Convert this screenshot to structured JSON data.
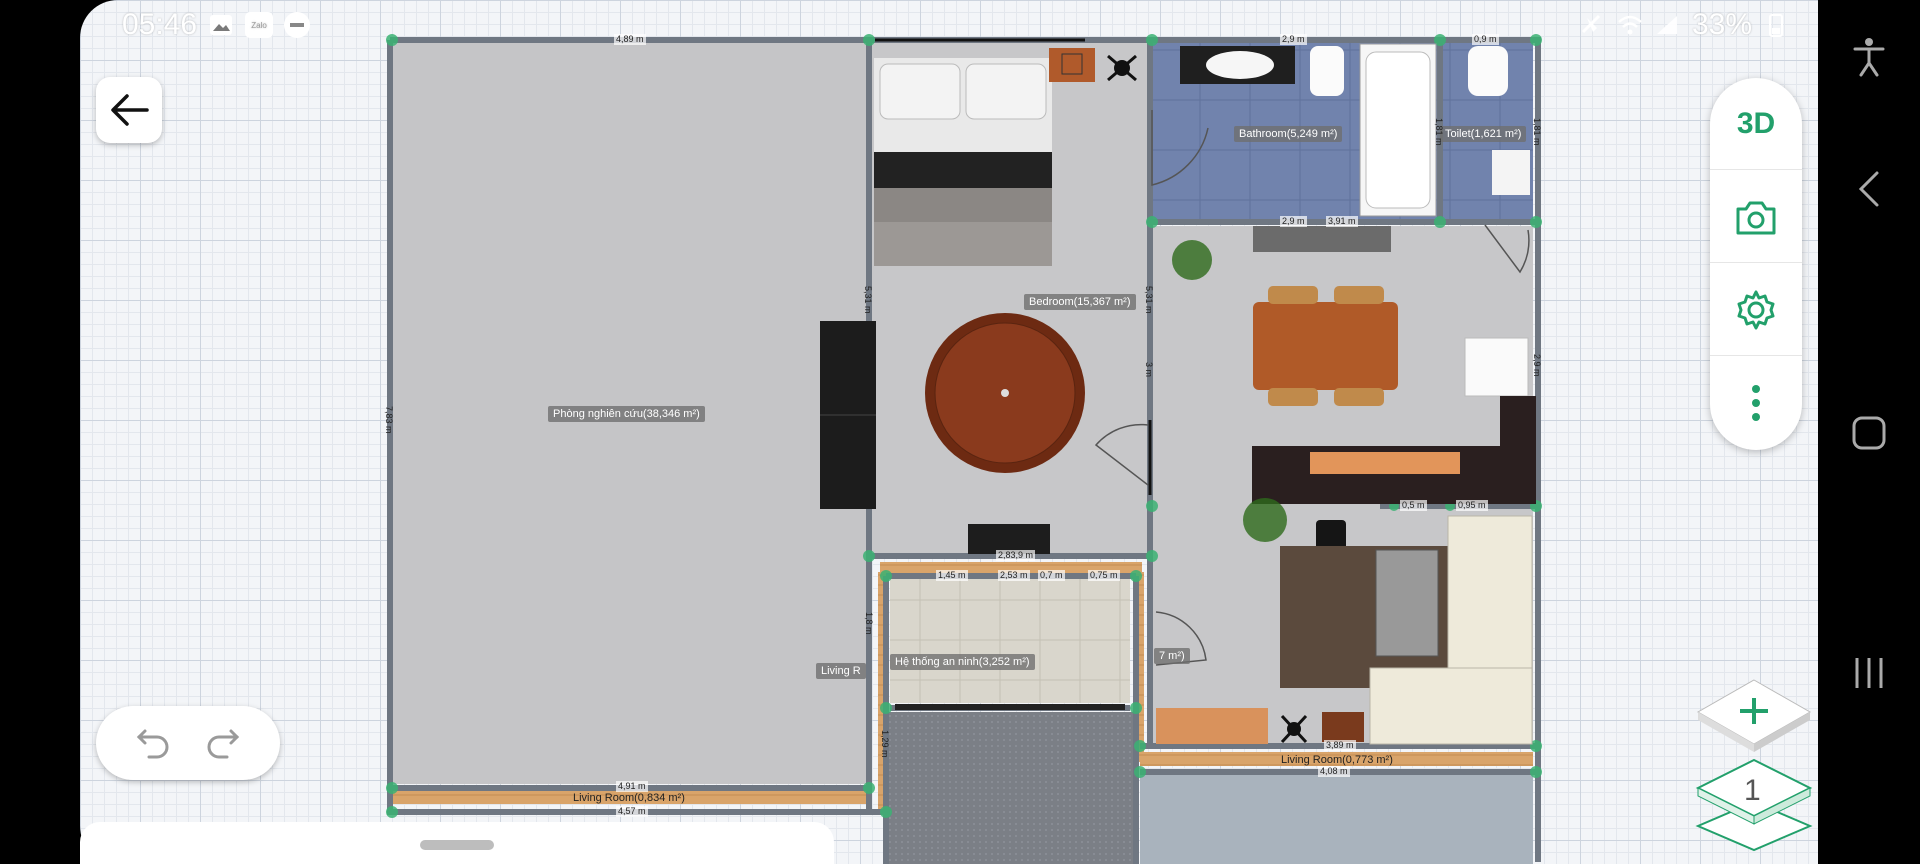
{
  "status_bar": {
    "time": "05:46",
    "notif_badge": "Zalo",
    "battery": "33%"
  },
  "rooms": {
    "study": "Phòng nghiên cứu(38,346 m²)",
    "bedroom": "Bedroom(15,367 m²)",
    "bathroom": "Bathroom(5,249 m²)",
    "toilet": "Toilet(1,621 m²)",
    "security": "Hệ thống an ninh(3,252 m²)",
    "living_small_left": "Living R",
    "living_partial": "7 m²)",
    "living_a": "Living Room(0,834 m²)",
    "living_b": "Living Room(0,773 m²)"
  },
  "dimensions": {
    "top_study": "4,89 m",
    "top_bath": "2,9 m",
    "top_toilet": "0,9 m",
    "bath_bottom_a": "2,9 m",
    "bath_bottom_b": "3,91 m",
    "bath_side": "1,81 m",
    "toilet_side": "1,81 m",
    "bedroom_left": "5,31 m",
    "bedroom_right": "5,31 m",
    "kitchen_side": "3 m",
    "kitchen_right": "2,9 m",
    "study_left": "7,83 m",
    "corr_a": "0,5 m",
    "corr_b": "0,95 m",
    "sec_top_a": "2,83,9 m",
    "sec_top_b": "1,45 m",
    "sec_top_c": "2,53 m",
    "sec_top_d": "0,7 m",
    "sec_top_e": "0,75 m",
    "sec_left": "1,8 m",
    "sec_left2": "1,29 m",
    "study_bottom": "4,91 m",
    "study_bottom2": "4,57 m",
    "living_bottom": "3,89 m",
    "living_bottom2": "4,08 m"
  },
  "controls": {
    "btn_3d": "3D",
    "floor_number": "1"
  },
  "icons": [
    "back-arrow-icon",
    "undo-icon",
    "redo-icon",
    "camera-icon",
    "gear-icon",
    "more-vert-icon",
    "add-icon",
    "floor-layer-icon",
    "accessibility-icon",
    "nav-back-icon",
    "nav-home-icon",
    "nav-recents-icon"
  ],
  "colors": {
    "accent": "#22a06b",
    "wall": "#6f7782",
    "floor_gray": "#c7c7c9",
    "bath_tile": "#6f83b0",
    "wood": "#d9a46a"
  }
}
